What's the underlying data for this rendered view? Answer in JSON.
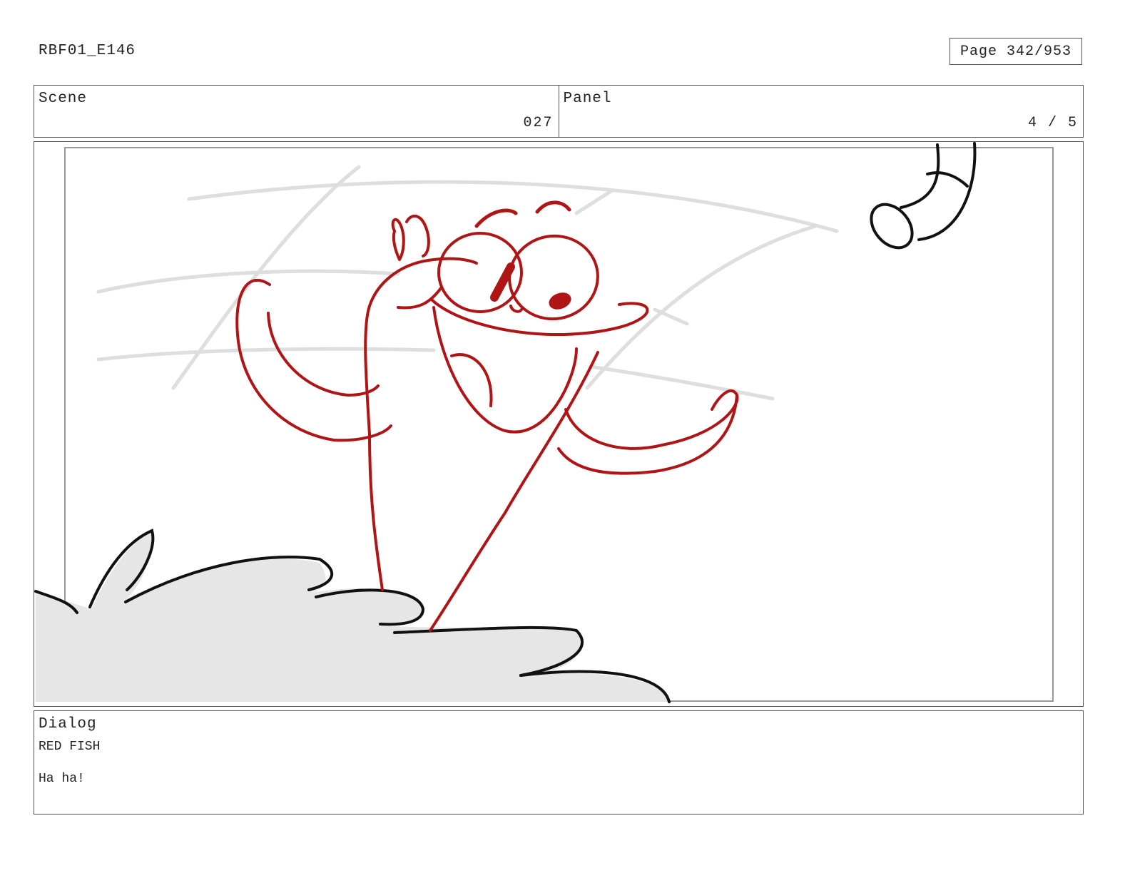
{
  "header": {
    "doc_id": "RBF01_E146",
    "page_label": "Page 342/953"
  },
  "info": {
    "scene_label": "Scene",
    "scene_value": "027",
    "panel_label": "Panel",
    "panel_value": "4 / 5"
  },
  "dialog": {
    "label": "Dialog",
    "speaker": "RED FISH",
    "line": "Ha ha!"
  },
  "colors": {
    "red_ink": "#b01515",
    "black_ink": "#111111",
    "sketch_gray": "#dedede",
    "fill_gray": "#e6e6e6"
  }
}
